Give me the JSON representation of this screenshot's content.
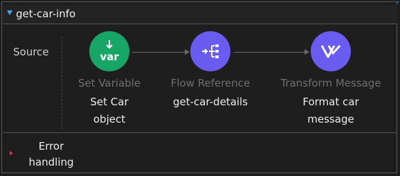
{
  "flow": {
    "name": "get-car-info",
    "source_label": "Source"
  },
  "processors": [
    {
      "type": "Set Variable",
      "name_lines": [
        "Set Car",
        "object"
      ],
      "icon": "var-icon",
      "icon_text": "var",
      "color": "#17a665"
    },
    {
      "type": "Flow Reference",
      "name_lines": [
        "get-car-details"
      ],
      "icon": "flow-reference-icon",
      "color": "#6a5cf0"
    },
    {
      "type": "Transform Message",
      "name_lines": [
        "Format car",
        "message"
      ],
      "icon": "dataweave-icon",
      "color": "#6a5cf0"
    }
  ],
  "error_handling": {
    "label_lines": [
      "Error",
      "handling"
    ],
    "toggle_color": "#d23a5a"
  },
  "colors": {
    "background": "#1e1e1e",
    "accent_top": "#2f6fb0",
    "collapse_icon": "#4aa3e8"
  }
}
